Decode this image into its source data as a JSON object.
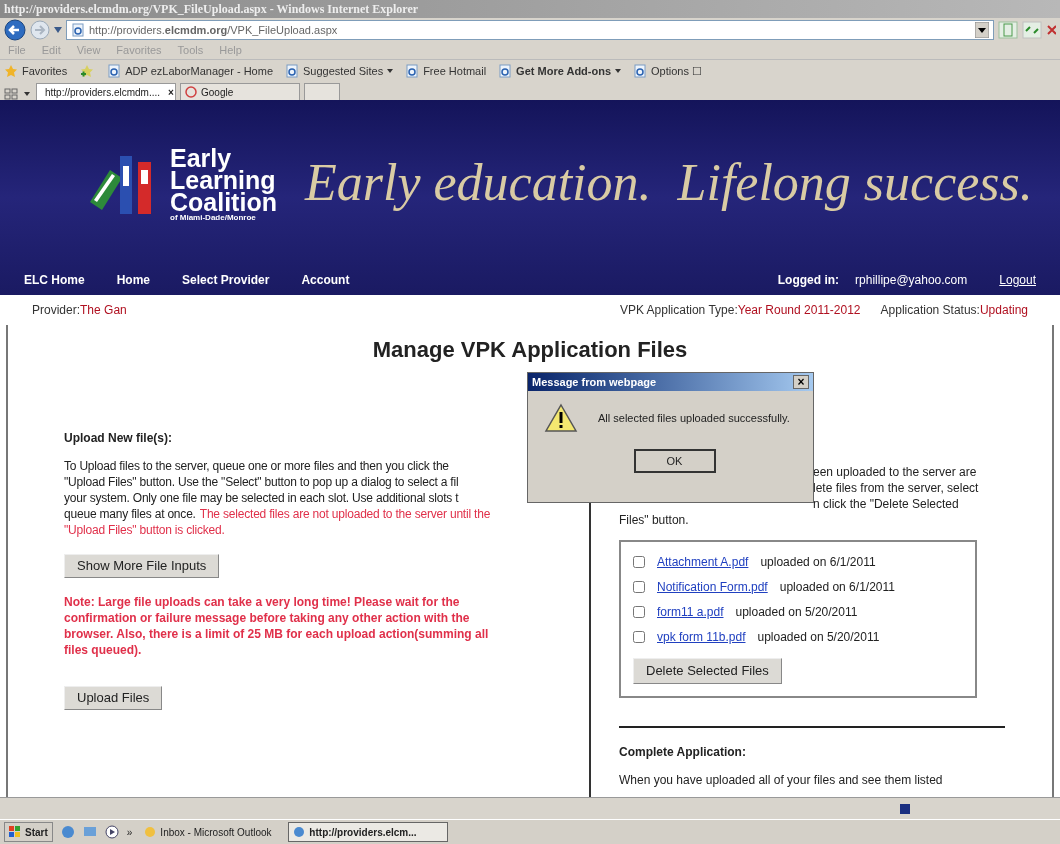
{
  "browser": {
    "window_title": "http://providers.elcmdm.org/VPK_FileUpload.aspx - Windows Internet Explorer",
    "address": "http://providers.**elcmdm.org**/VPK_FileUpload.aspx",
    "menu": [
      "File",
      "Edit",
      "View",
      "Favorites",
      "Tools",
      "Help"
    ],
    "favorites_label": "Favorites",
    "favorites": [
      {
        "label": "ADP ezLaborManager - Home",
        "dropdown": false,
        "bold": false
      },
      {
        "label": "Suggested Sites",
        "dropdown": true,
        "bold": false
      },
      {
        "label": "Free Hotmail",
        "dropdown": false,
        "bold": false
      },
      {
        "label": "Get More Add-ons",
        "dropdown": true,
        "bold": true
      },
      {
        "label": "Options ☐",
        "dropdown": false,
        "bold": false
      }
    ],
    "tabs": [
      {
        "label": "http://providers.elcmdm....",
        "selected": true,
        "close": "×"
      },
      {
        "label": "Google",
        "selected": false
      }
    ]
  },
  "site": {
    "logo": [
      "Early",
      "Learning",
      "Coalition"
    ],
    "logo_sub": "of Miami-Dade/Monroe",
    "tagline": "Early education.  Lifelong success.",
    "nav": [
      "ELC Home",
      "Home",
      "Select Provider",
      "Account"
    ],
    "logged_in_label": "Logged in:",
    "user": "rphillipe@yahoo.com",
    "logout": "Logout"
  },
  "info": {
    "provider_label": "Provider:",
    "provider": "The Gan",
    "type_label": "VPK Application Type:",
    "type": "Year Round 2011-2012",
    "status_label": "Application Status:",
    "status": "Updating"
  },
  "heading": "Manage VPK Application Files",
  "upload": {
    "title": "Upload New file(s):",
    "lines": [
      "To Upload files to the server, queue one or more files and then you click the",
      "\"Upload Files\" button. Use the \"Select\" button to pop up a dialog to select a fil",
      "your system. Only one file may be selected in each slot. Use additional slots t"
    ],
    "last_line": "queue many files at once.",
    "warning_lines": [
      "The selected files are not uploaded to the server until the",
      "\"Upload Files\" button is clicked."
    ],
    "more_button": "Show More File Inputs",
    "note": "Note: Large file uploads can take a very long time! Please wait for the confirmation or failure message before taking any other action with the browser. Also, there is a limit of 25 MB for each upload action(summing all files queued).",
    "upload_button": "Upload Files"
  },
  "uploaded": {
    "lines": [
      "een uploaded to the server are",
      "lete files from the server, select",
      "n click the \"Delete Selected",
      "Files\" button."
    ],
    "files": [
      {
        "name": "Attachment A.pdf",
        "date": "uploaded on 6/1/2011",
        "checked": false
      },
      {
        "name": "Notification Form.pdf",
        "date": "uploaded on 6/1/2011",
        "checked": false
      },
      {
        "name": "form11 a.pdf",
        "date": "uploaded on 5/20/2011",
        "checked": false
      },
      {
        "name": "vpk form 11b.pdf",
        "date": "uploaded on 5/20/2011",
        "checked": false
      }
    ],
    "delete_button": "Delete Selected Files"
  },
  "complete": {
    "title": "Complete Application:",
    "text": "When you have uploaded all of your files and see them listed"
  },
  "dialog": {
    "title": "Message from webpage",
    "close": "×",
    "message": "All selected files uploaded successfully.",
    "ok": "OK"
  },
  "taskbar": {
    "start": "Start",
    "more": "»",
    "items": [
      {
        "label": "Inbox - Microsoft Outlook",
        "selected": false
      },
      {
        "label": "http://providers.elcm...",
        "selected": true
      }
    ]
  }
}
